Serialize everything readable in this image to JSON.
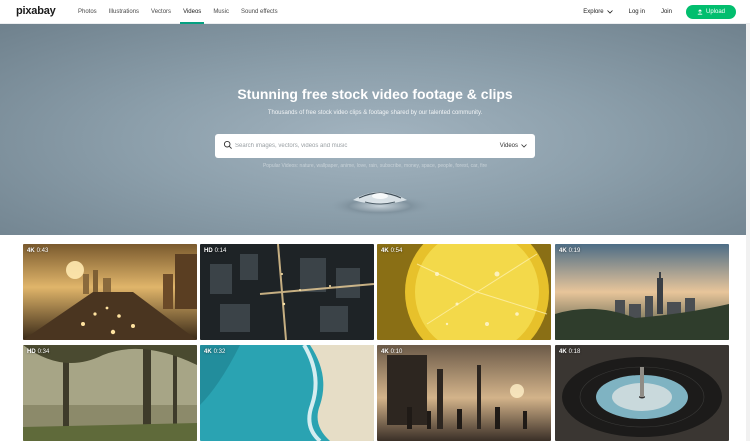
{
  "header": {
    "logo": "pixabay",
    "nav": [
      "Photos",
      "Illustrations",
      "Vectors",
      "Videos",
      "Music",
      "Sound effects"
    ],
    "active_nav": "Videos",
    "explore": "Explore",
    "login": "Log in",
    "join": "Join",
    "upload": "Upload"
  },
  "hero": {
    "title": "Stunning free stock video footage & clips",
    "subtitle": "Thousands of free stock video clips & footage shared by our talented community.",
    "search_placeholder": "Search images, vectors, videos and music",
    "search_type": "Videos",
    "popular": "Popular Videos: nature, wallpaper, anime, love, rain, subscribe, money, space, people, forest, car, fire"
  },
  "videos": [
    {
      "quality": "4K",
      "duration": "0:43",
      "scene": "city-sunset-traffic"
    },
    {
      "quality": "HD",
      "duration": "0:14",
      "scene": "aerial-night-city"
    },
    {
      "quality": "4K",
      "duration": "0:54",
      "scene": "lemon-soda"
    },
    {
      "quality": "4K",
      "duration": "0:19",
      "scene": "city-skyline-sunset"
    },
    {
      "quality": "HD",
      "duration": "0:34",
      "scene": "misty-forest"
    },
    {
      "quality": "4K",
      "duration": "0:32",
      "scene": "aerial-beach"
    },
    {
      "quality": "4K",
      "duration": "0:10",
      "scene": "street-people-sunset"
    },
    {
      "quality": "4K",
      "duration": "0:18",
      "scene": "vinyl-record"
    }
  ],
  "colors": {
    "accent": "#05a081",
    "upload_button": "#02be6e",
    "hero_bg": "#8c9fab"
  }
}
